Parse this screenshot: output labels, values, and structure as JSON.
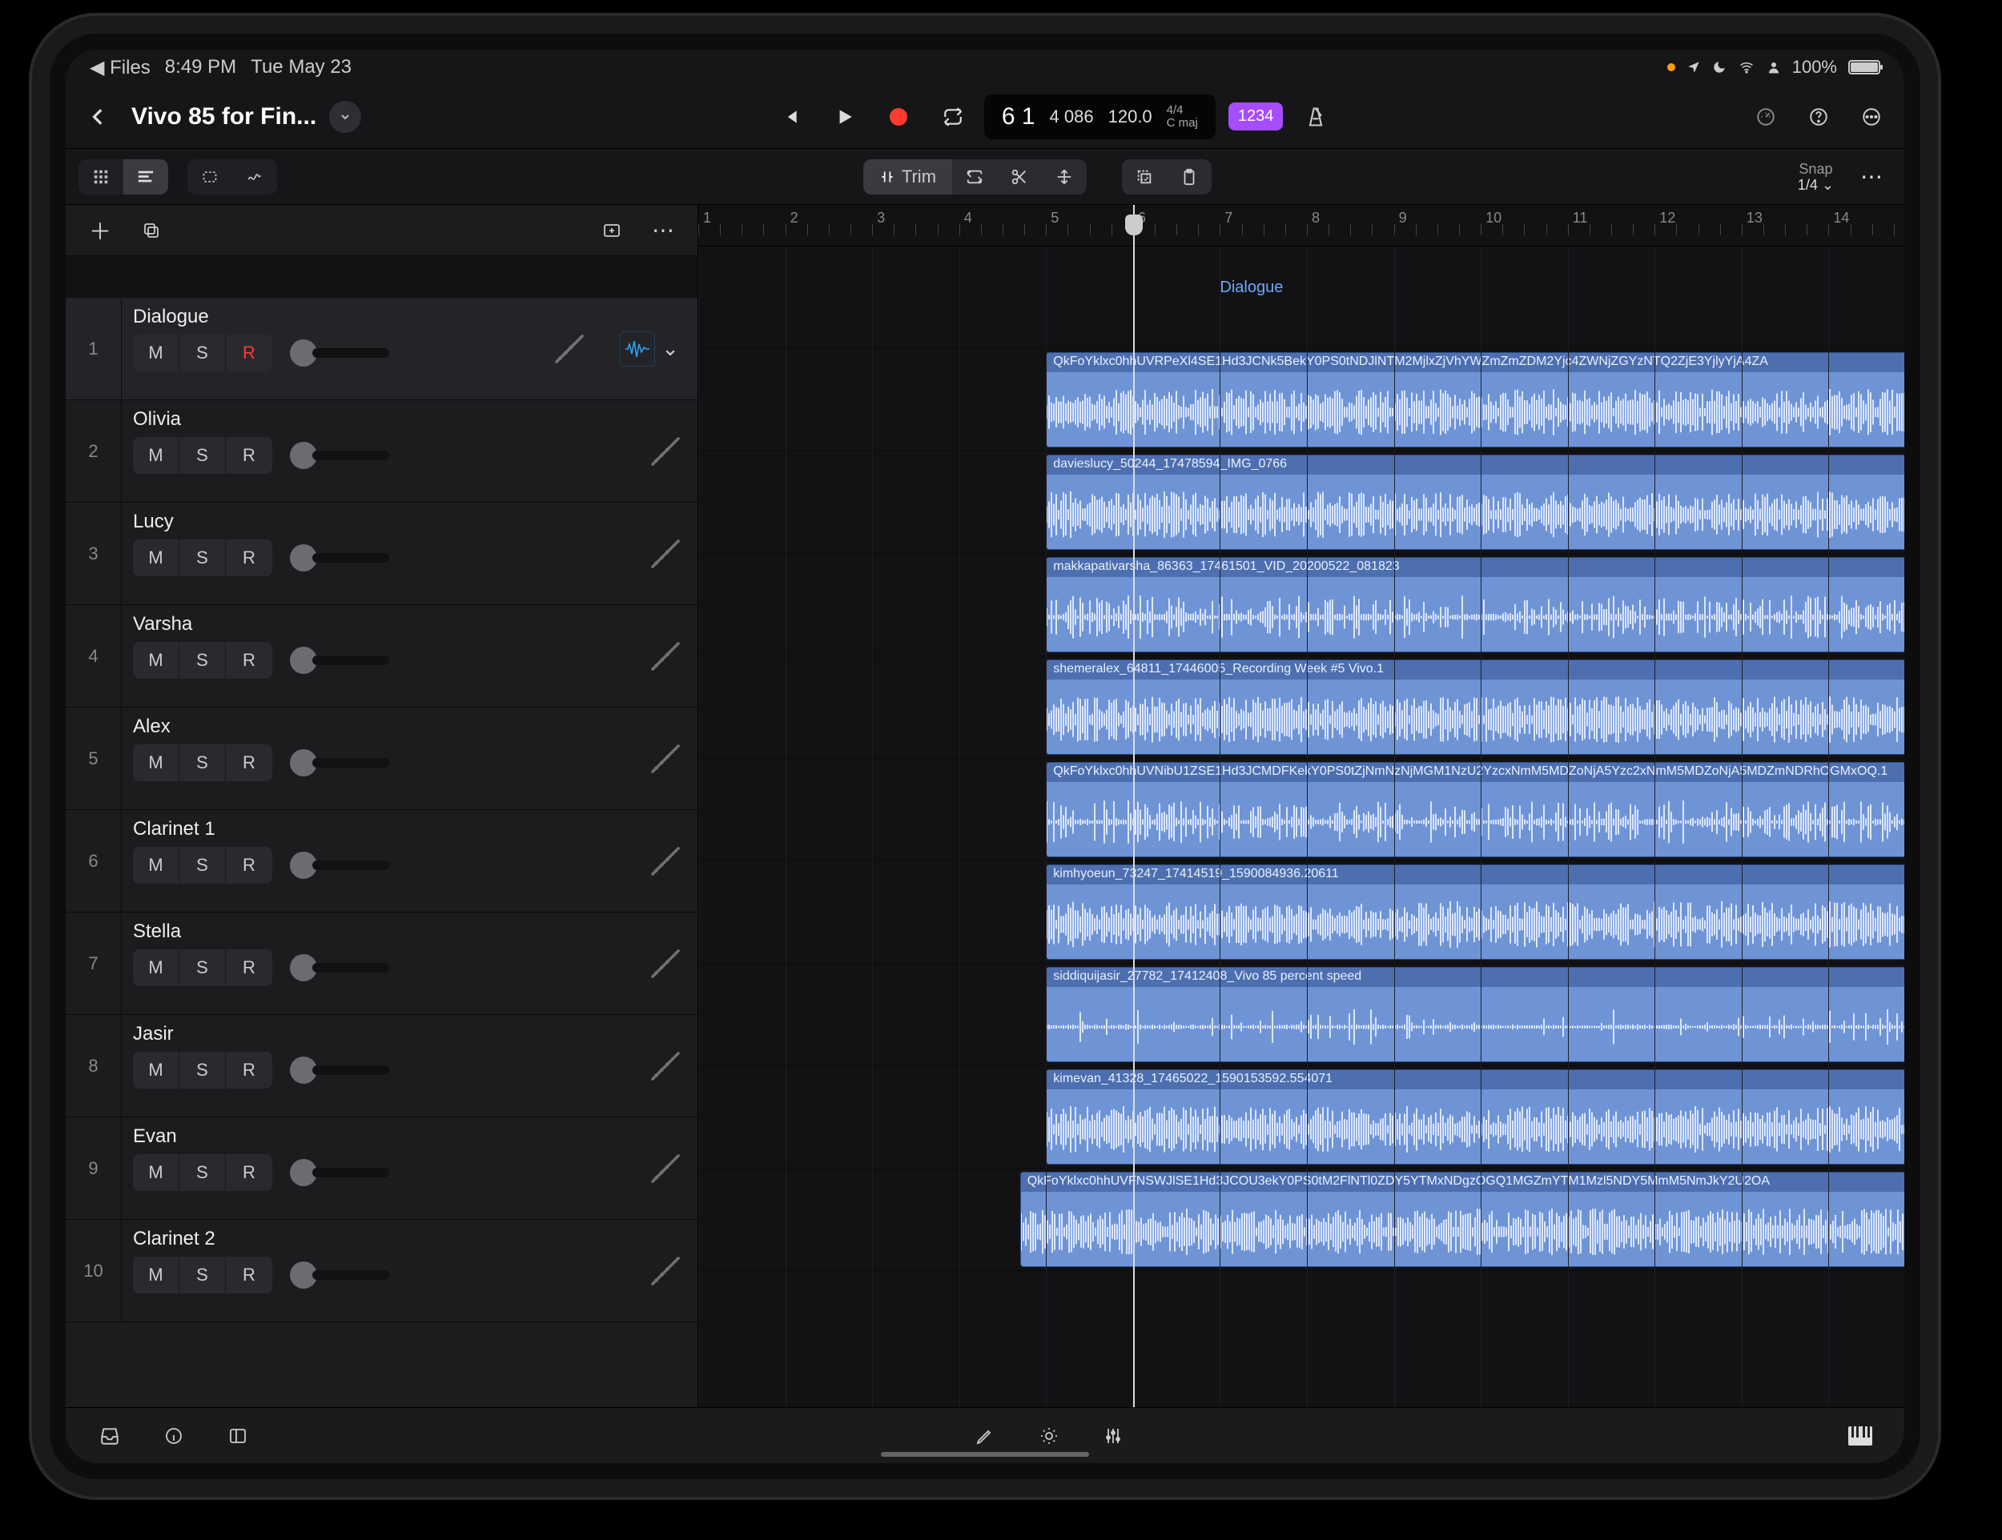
{
  "status": {
    "back_app": "Files",
    "time": "8:49 PM",
    "date": "Tue May 23",
    "battery": "100%"
  },
  "header": {
    "title": "Vivo 85 for Fin...",
    "lcd_bar_beat": "6 1",
    "lcd_frames": "4 086",
    "lcd_tempo": "120.0",
    "lcd_sig_top": "4/4",
    "lcd_sig_bot": "C maj",
    "count_in": "1234"
  },
  "toolrow": {
    "trim_label": "Trim",
    "snap_title": "Snap",
    "snap_value": "1/4"
  },
  "ruler": {
    "start": 1,
    "end": 15,
    "playhead_bar": 6
  },
  "tracks": [
    {
      "num": 1,
      "name": "Dialogue",
      "rec_armed": true,
      "selected": true,
      "region": null,
      "lane_label": "Dialogue"
    },
    {
      "num": 2,
      "name": "Olivia",
      "region": {
        "title": "QkFoYklxc0hhUVRPeXl4SE1Hd3JCNk5BekY0PS0tNDJlNTM2MjlxZjVhYWZmZmZDM2Yjc4ZWNjZGYzNTQ2ZjE3YjlyYjA4ZA",
        "start": 5,
        "end": 15
      }
    },
    {
      "num": 3,
      "name": "Lucy",
      "region": {
        "title": "davieslucy_50244_17478594_IMG_0766",
        "start": 5,
        "end": 15
      }
    },
    {
      "num": 4,
      "name": "Varsha",
      "region": {
        "title": "makkapativarsha_86363_17461501_VID_20200522_081823",
        "start": 5,
        "end": 15
      }
    },
    {
      "num": 5,
      "name": "Alex",
      "region": {
        "title": "shemeralex_64811_17446005_Recording Week #5 Vivo.1",
        "start": 5,
        "end": 15
      }
    },
    {
      "num": 6,
      "name": "Clarinet 1",
      "region": {
        "title": "QkFoYklxc0hhUVNibU1ZSE1Hd3JCMDFKekY0PS0tZjNmNzNjMGM1NzU2YzcxNmM5MDZoNjA5Yzc2xNmM5MDZoNjA5MDZmNDRhOGMxOQ.1",
        "start": 5,
        "end": 15
      }
    },
    {
      "num": 7,
      "name": "Stella",
      "region": {
        "title": "kimhyoeun_73247_17414519_1590084936.20611",
        "start": 5,
        "end": 15
      }
    },
    {
      "num": 8,
      "name": "Jasir",
      "region": {
        "title": "siddiquijasir_27782_17412408_Vivo 85 percent speed",
        "start": 5,
        "end": 15
      }
    },
    {
      "num": 9,
      "name": "Evan",
      "region": {
        "title": "kimevan_41328_17465022_1590153592.554071",
        "start": 5,
        "end": 15
      }
    },
    {
      "num": 10,
      "name": "Clarinet 2",
      "region": {
        "title": "QkFoYklxc0hhUVFNSWJlSE1Hd3JCOU3ekY0PS0tM2FlNTl0ZDY5YTMxNDgzOGQ1MGZmYTM1Mzl5NDY5MmM5NmJkY2U2OA",
        "start": 4.7,
        "end": 15
      }
    }
  ],
  "bottom": {}
}
